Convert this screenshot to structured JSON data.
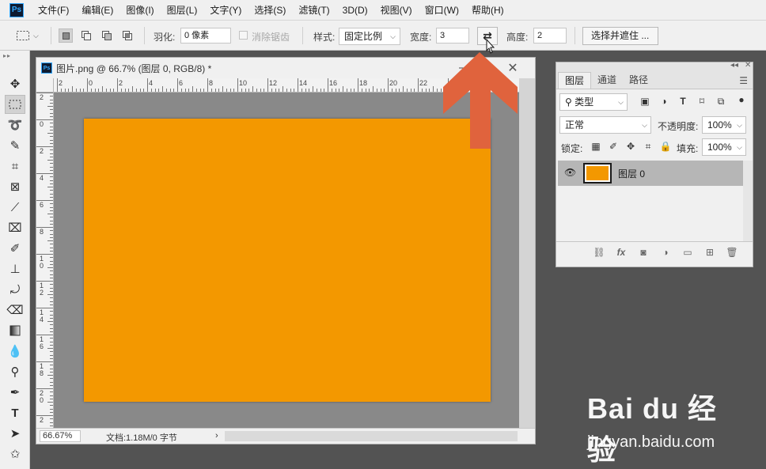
{
  "menubar": {
    "logo": "Ps",
    "items": [
      "文件(F)",
      "编辑(E)",
      "图像(I)",
      "图层(L)",
      "文字(Y)",
      "选择(S)",
      "滤镜(T)",
      "3D(D)",
      "视图(V)",
      "窗口(W)",
      "帮助(H)"
    ]
  },
  "options": {
    "feather_label": "羽化:",
    "feather_value": "0 像素",
    "antialias_label": "消除锯齿",
    "style_label": "样式:",
    "style_value": "固定比例",
    "width_label": "宽度:",
    "width_value": "3",
    "swap_icon": "⇄",
    "height_label": "高度:",
    "height_value": "2",
    "select_mask_button": "选择并遮住 ..."
  },
  "document": {
    "title": "图片.png @ 66.7% (图层 0, RGB/8) *",
    "canvas_color": "#f39800",
    "pasteboard_color": "#898989",
    "ruler_h_labels": [
      "2",
      "0",
      "2",
      "4",
      "6",
      "8",
      "10",
      "12",
      "14",
      "16",
      "18",
      "20",
      "22",
      "24"
    ],
    "ruler_v_labels": [
      "2",
      "0",
      "2",
      "4",
      "6",
      "8",
      "1\n0",
      "1\n2",
      "1\n4",
      "1\n6",
      "1\n8",
      "2\n0",
      "2"
    ],
    "zoom": "66.67%",
    "doc_info": "文档:1.18M/0 字节",
    "status_arrow": "›"
  },
  "layers_panel": {
    "tabs": [
      "图层",
      "通道",
      "路径"
    ],
    "filter_kind": "类型",
    "blend_mode": "正常",
    "opacity_label": "不透明度:",
    "opacity_value": "100%",
    "lock_label": "锁定:",
    "fill_label": "填充:",
    "fill_value": "100%",
    "layer_name": "图层 0",
    "layer_color": "#f39800"
  },
  "annotation": {
    "arrow_color": "#e0633d"
  },
  "watermark": {
    "logo": "Bai du 经验",
    "url": "jingyan.baidu.com"
  }
}
